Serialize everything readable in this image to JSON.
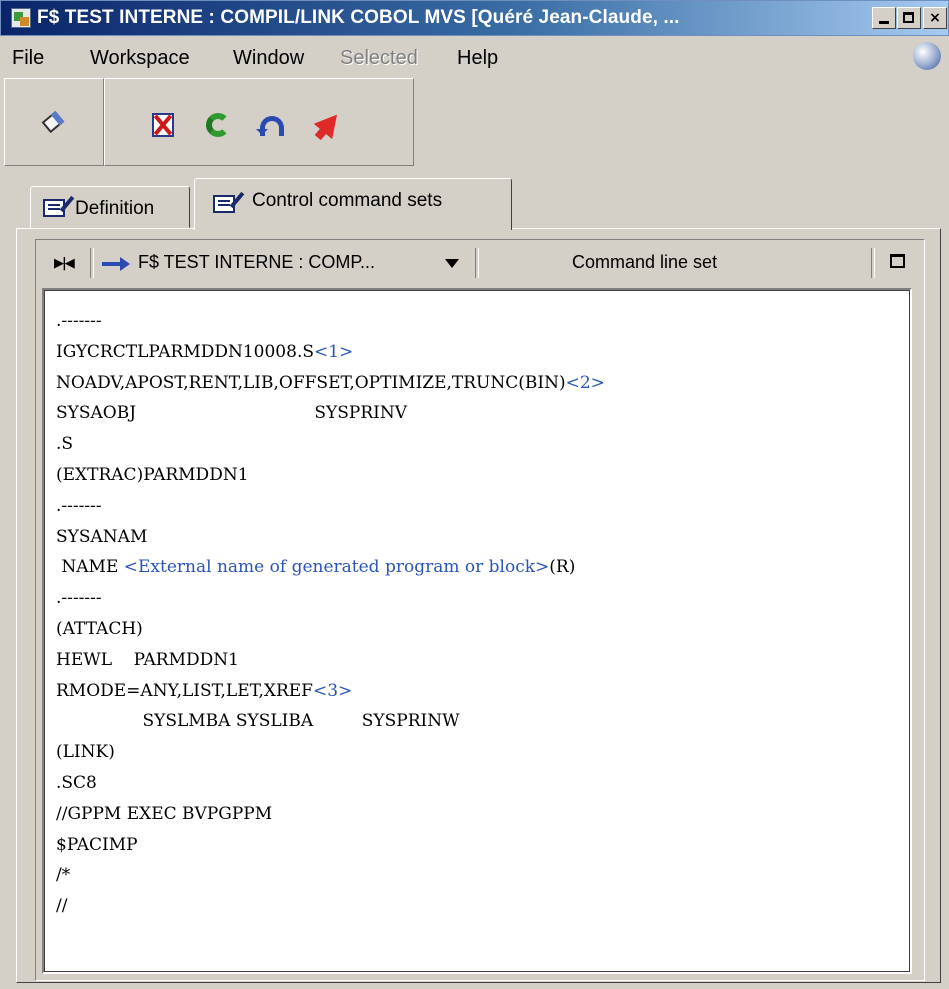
{
  "window": {
    "title": "F$ TEST INTERNE : COMPIL/LINK COBOL MVS [Quéré Jean-Claude, ...",
    "buttons": {
      "minimize": "minimize",
      "maximize": "maximize",
      "close": "×"
    }
  },
  "menu": {
    "file": "File",
    "workspace": "Workspace",
    "window": "Window",
    "selected": "Selected",
    "help": "Help"
  },
  "toolbar": {
    "icons": [
      "eraser-icon",
      "delete-icon",
      "refresh-icon",
      "undo-icon",
      "arrow-icon"
    ]
  },
  "tabs": {
    "definition": "Definition",
    "control_command_sets": "Control command sets",
    "active": "control_command_sets"
  },
  "panel": {
    "title": "F$ TEST INTERNE : COMP...",
    "right_label": "Command line set"
  },
  "editor": {
    "lines": [
      {
        "text": ".-------",
        "var": ""
      },
      {
        "text": "IGYCRCTLPARMDDN10008.S",
        "var": "<1>"
      },
      {
        "text": "NOADV,APOST,RENT,LIB,OFFSET,OPTIMIZE,TRUNC(BIN)",
        "var": "<2>"
      },
      {
        "text": "SYSAOBJ                                 SYSPRINV",
        "var": ""
      },
      {
        "text": ".S",
        "var": ""
      },
      {
        "text": "(EXTRAC)PARMDDN1",
        "var": ""
      },
      {
        "text": ".-------",
        "var": ""
      },
      {
        "text": "SYSANAM",
        "var": ""
      },
      {
        "text": " NAME ",
        "var": "<External name of generated program or block>",
        "after": "(R)"
      },
      {
        "text": ".-------",
        "var": ""
      },
      {
        "text": "(ATTACH)",
        "var": ""
      },
      {
        "text": "HEWL    PARMDDN1",
        "var": ""
      },
      {
        "text": "RMODE=ANY,LIST,LET,XREF",
        "var": "<3>"
      },
      {
        "text": "                SYSLMBA SYSLIBA         SYSPRINW",
        "var": ""
      },
      {
        "text": "(LINK)",
        "var": ""
      },
      {
        "text": ".SC8",
        "var": ""
      },
      {
        "text": "//GPPM EXEC BVPGPPM",
        "var": ""
      },
      {
        "text": "$PACIMP",
        "var": ""
      },
      {
        "text": "/*",
        "var": ""
      },
      {
        "text": "//",
        "var": ""
      }
    ]
  },
  "colors": {
    "title_start": "#0a246a",
    "title_end": "#a6caf0",
    "face": "#d4d0c8",
    "variable": "#2a55b8"
  }
}
